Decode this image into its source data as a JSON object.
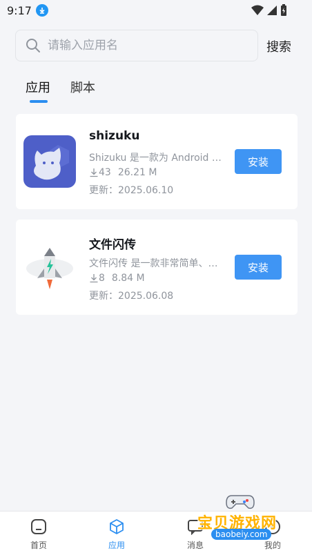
{
  "status_bar": {
    "time": "9:17"
  },
  "search": {
    "placeholder": "请输入应用名",
    "button_label": "搜索"
  },
  "tabs": [
    {
      "label": "应用",
      "active": true
    },
    {
      "label": "脚本",
      "active": false
    }
  ],
  "apps": [
    {
      "name": "shizuku",
      "description": "Shizuku 是一款为 Android 设备设计的工具",
      "downloads": "43",
      "size": "26.21 M",
      "updated": "更新：2025.06.10",
      "install_label": "安装",
      "icon": "shizuku-app-icon"
    },
    {
      "name": "文件闪传",
      "description": "文件闪传 是一款非常简单、便捷的文件传输工具",
      "downloads": "8",
      "size": "8.84 M",
      "updated": "更新：2025.06.08",
      "install_label": "安装",
      "icon": "rocket-app-icon"
    }
  ],
  "bottom_nav": [
    {
      "label": "首页",
      "icon": "home-icon",
      "active": false
    },
    {
      "label": "应用",
      "icon": "cube-icon",
      "active": true
    },
    {
      "label": "消息",
      "icon": "message-icon",
      "active": false
    },
    {
      "label": "我的",
      "icon": "user-icon",
      "active": false
    }
  ],
  "watermark": {
    "text": "宝贝游戏网",
    "url": "baobeiy.com"
  },
  "colors": {
    "accent": "#2b8ef0",
    "install_button": "#3f95f4",
    "background": "#f4f5f8"
  }
}
